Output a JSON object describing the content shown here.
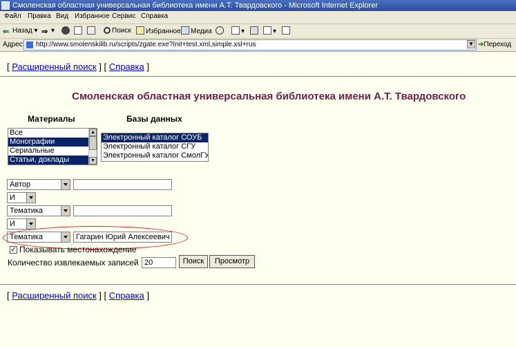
{
  "window": {
    "title": "Смоленская областная универсальная библиотека имени А.Т. Твардовского - Microsoft Internet Explorer"
  },
  "menu": [
    "Файл",
    "Правка",
    "Вид",
    "Избранное",
    "Сервис",
    "Справка"
  ],
  "toolbar": {
    "back": "Назад",
    "search": "Поиск",
    "favorites": "Избранное",
    "media": "Медиа"
  },
  "address": {
    "label": "Адрес:",
    "url": "http://www.smolenskilib.ru/scripts/zgate.exe?Init+test.xml,simple.xsl+rus",
    "go": "Переход"
  },
  "nav": {
    "open_bracket": "[",
    "advanced_search": "Расширенный поиск",
    "separator": "] [",
    "help": "Справка",
    "close_bracket": "]"
  },
  "page": {
    "heading": "Смоленская областная универсальная библиотека имени А.Т. Твардовского"
  },
  "materials": {
    "label": "Материалы",
    "options": [
      "Все",
      "Монографии",
      "Сериальные",
      "Статьи, доклады"
    ]
  },
  "databases": {
    "label": "Базы данных",
    "options": [
      "Электронный каталог СОУБ",
      "Электронный каталог СГУ",
      "Электронный каталог СмолГУ"
    ]
  },
  "search_rows": [
    {
      "field": "Автор",
      "value": ""
    },
    {
      "operator": "И"
    },
    {
      "field": "Тематика",
      "value": ""
    },
    {
      "operator": "И"
    },
    {
      "field": "Тематика",
      "value": "Гагарин Юрий Алексеевич"
    }
  ],
  "options": {
    "show_location_label": "Показывать местонахождение",
    "show_location_checked": "✓",
    "records_label": "Количество извлекаемых записей",
    "records_value": "20"
  },
  "buttons": {
    "search": "Поиск",
    "preview": "Просмотр"
  },
  "colors": {
    "heading": "#6b1f46",
    "selection": "#0a246a",
    "link": "#0000cc",
    "highlight_oval": "#d02020"
  }
}
